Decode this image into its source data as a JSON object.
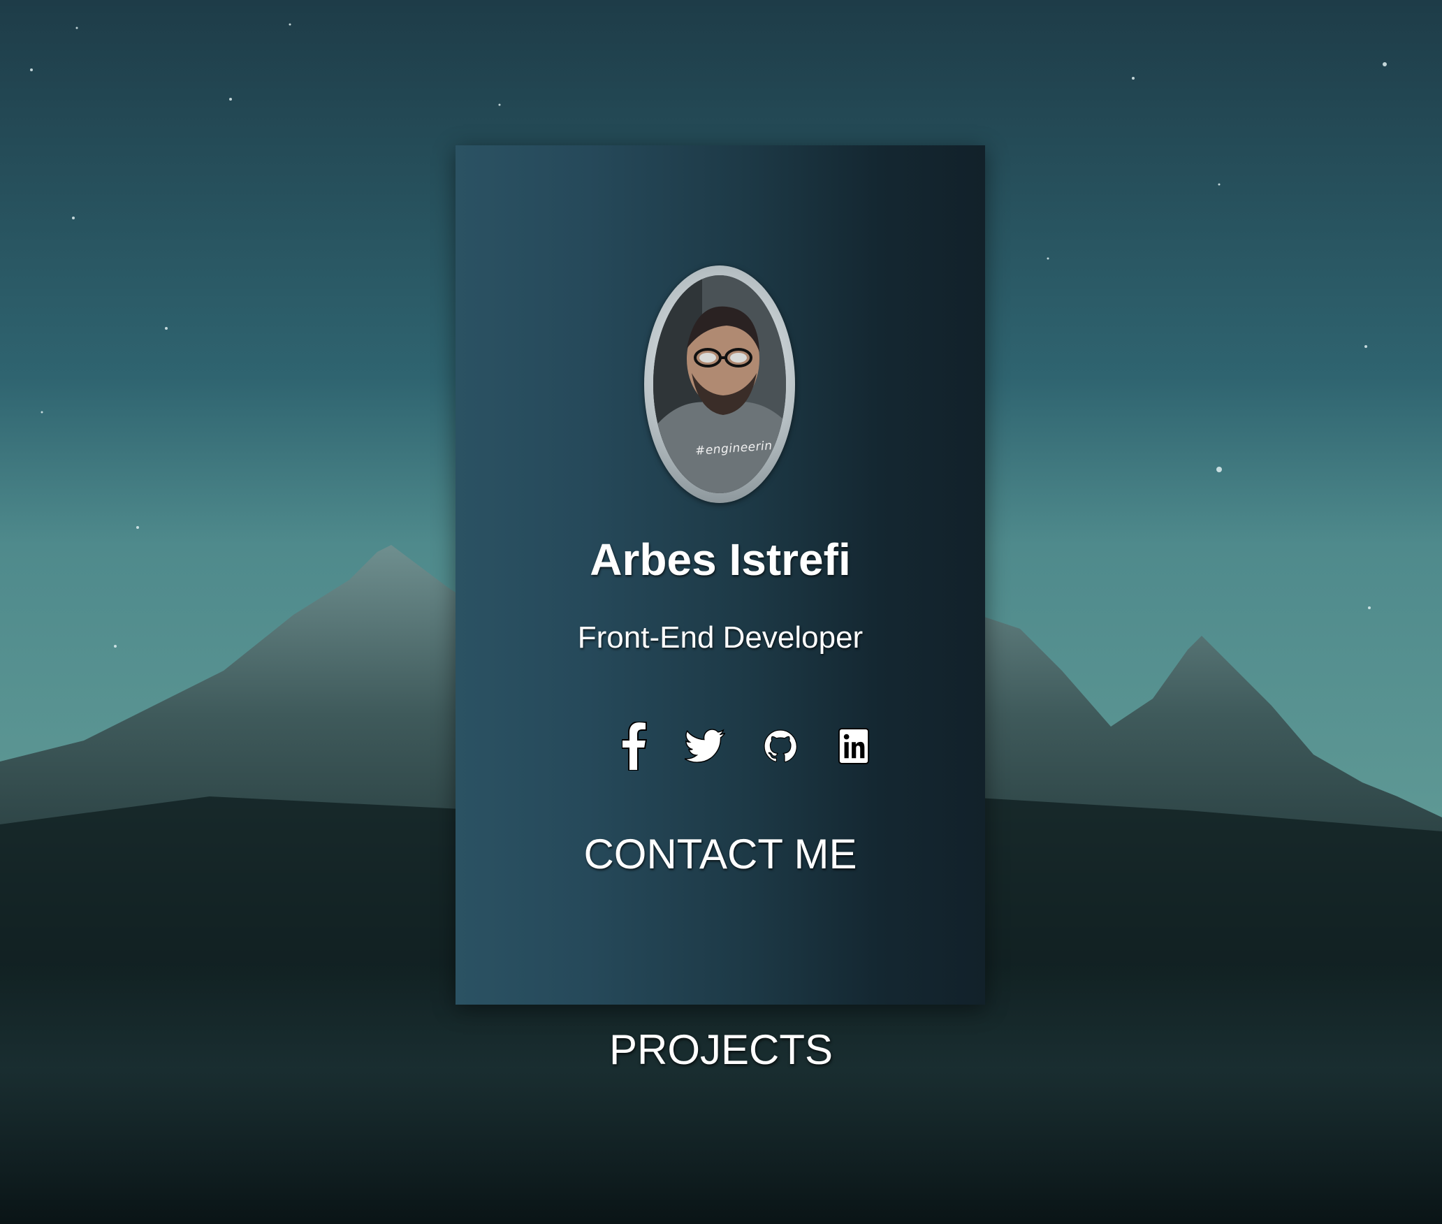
{
  "profile": {
    "name": "Arbes Istrefi",
    "role": "Front-End Developer",
    "photo_caption": "#engineerin"
  },
  "socials": [
    {
      "icon": "facebook-icon"
    },
    {
      "icon": "twitter-icon"
    },
    {
      "icon": "github-icon"
    },
    {
      "icon": "linkedin-icon"
    }
  ],
  "actions": {
    "contact_label": "CONTACT ME",
    "projects_label": "PROJECTS"
  },
  "colors": {
    "card_start": "#2b5263",
    "card_end": "#12212a",
    "text": "#ffffff"
  }
}
